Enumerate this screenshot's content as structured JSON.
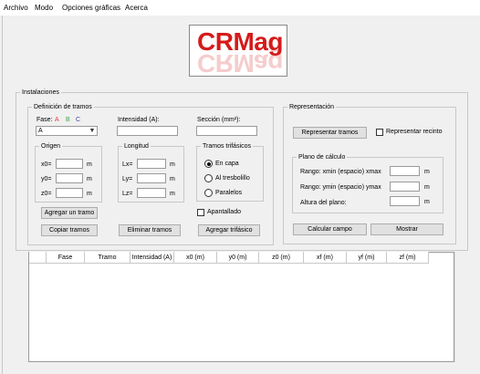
{
  "menu": [
    "Archivo",
    "Modo",
    "Opciones gráficas",
    "Acerca"
  ],
  "logo": {
    "text": "CRMag",
    "color": "#d61a1a"
  },
  "instalaciones": {
    "title": "Instalaciones",
    "definicion": {
      "title": "Definición de tramos",
      "fase_label": "Fase:",
      "fase_letters": [
        {
          "text": "A",
          "color": "#e53935"
        },
        {
          "text": "B",
          "color": "#43a047"
        },
        {
          "text": "C",
          "color": "#3949ab"
        }
      ],
      "fase_value": "A",
      "intensidad_label": "Intensidad (A):",
      "intensidad_value": "",
      "seccion_label": "Sección (mm²):",
      "seccion_value": "",
      "origen": {
        "title": "Origen",
        "fields": [
          {
            "label": "x0=",
            "value": "",
            "unit": "m"
          },
          {
            "label": "y0=",
            "value": "",
            "unit": "m"
          },
          {
            "label": "z0=",
            "value": "",
            "unit": "m"
          }
        ]
      },
      "longitud": {
        "title": "Longitud",
        "fields": [
          {
            "label": "Lx=",
            "value": "",
            "unit": "m"
          },
          {
            "label": "Ly=",
            "value": "",
            "unit": "m"
          },
          {
            "label": "Lz=",
            "value": "",
            "unit": "m"
          }
        ]
      },
      "trifasicos": {
        "title": "Tramos trifásicos",
        "options": [
          "En capa",
          "Al tresbolillo",
          "Paralelos"
        ],
        "selected": "En capa"
      },
      "apantallado_label": "Apantallado",
      "buttons": {
        "agregar_tramo": "Agregar un tramo",
        "copiar_tramos": "Copiar tramos",
        "eliminar_tramos": "Eliminar tramos",
        "agregar_trifasico": "Agregar trifásico"
      }
    },
    "representacion": {
      "title": "Representación",
      "representar_tramos": "Representar tramos",
      "representar_recinto": "Representar recinto",
      "plano": {
        "title": "Plano de cálculo",
        "fields": [
          {
            "label": "Rango: xmin (espacio) xmax",
            "value": "",
            "unit": "m"
          },
          {
            "label": "Rango: ymin (espacio) ymax",
            "value": "",
            "unit": "m"
          },
          {
            "label": "Altura del plano:",
            "value": "",
            "unit": "m"
          }
        ]
      },
      "calcular_campo": "Calcular campo",
      "mostrar": "Mostrar"
    }
  },
  "table": {
    "columns": [
      "",
      "Fase",
      "Tramo",
      "Intensidad (A)",
      "x0 (m)",
      "y0 (m)",
      "z0 (m)",
      "xf (m)",
      "yf (m)",
      "zf (m)"
    ],
    "rows": []
  }
}
